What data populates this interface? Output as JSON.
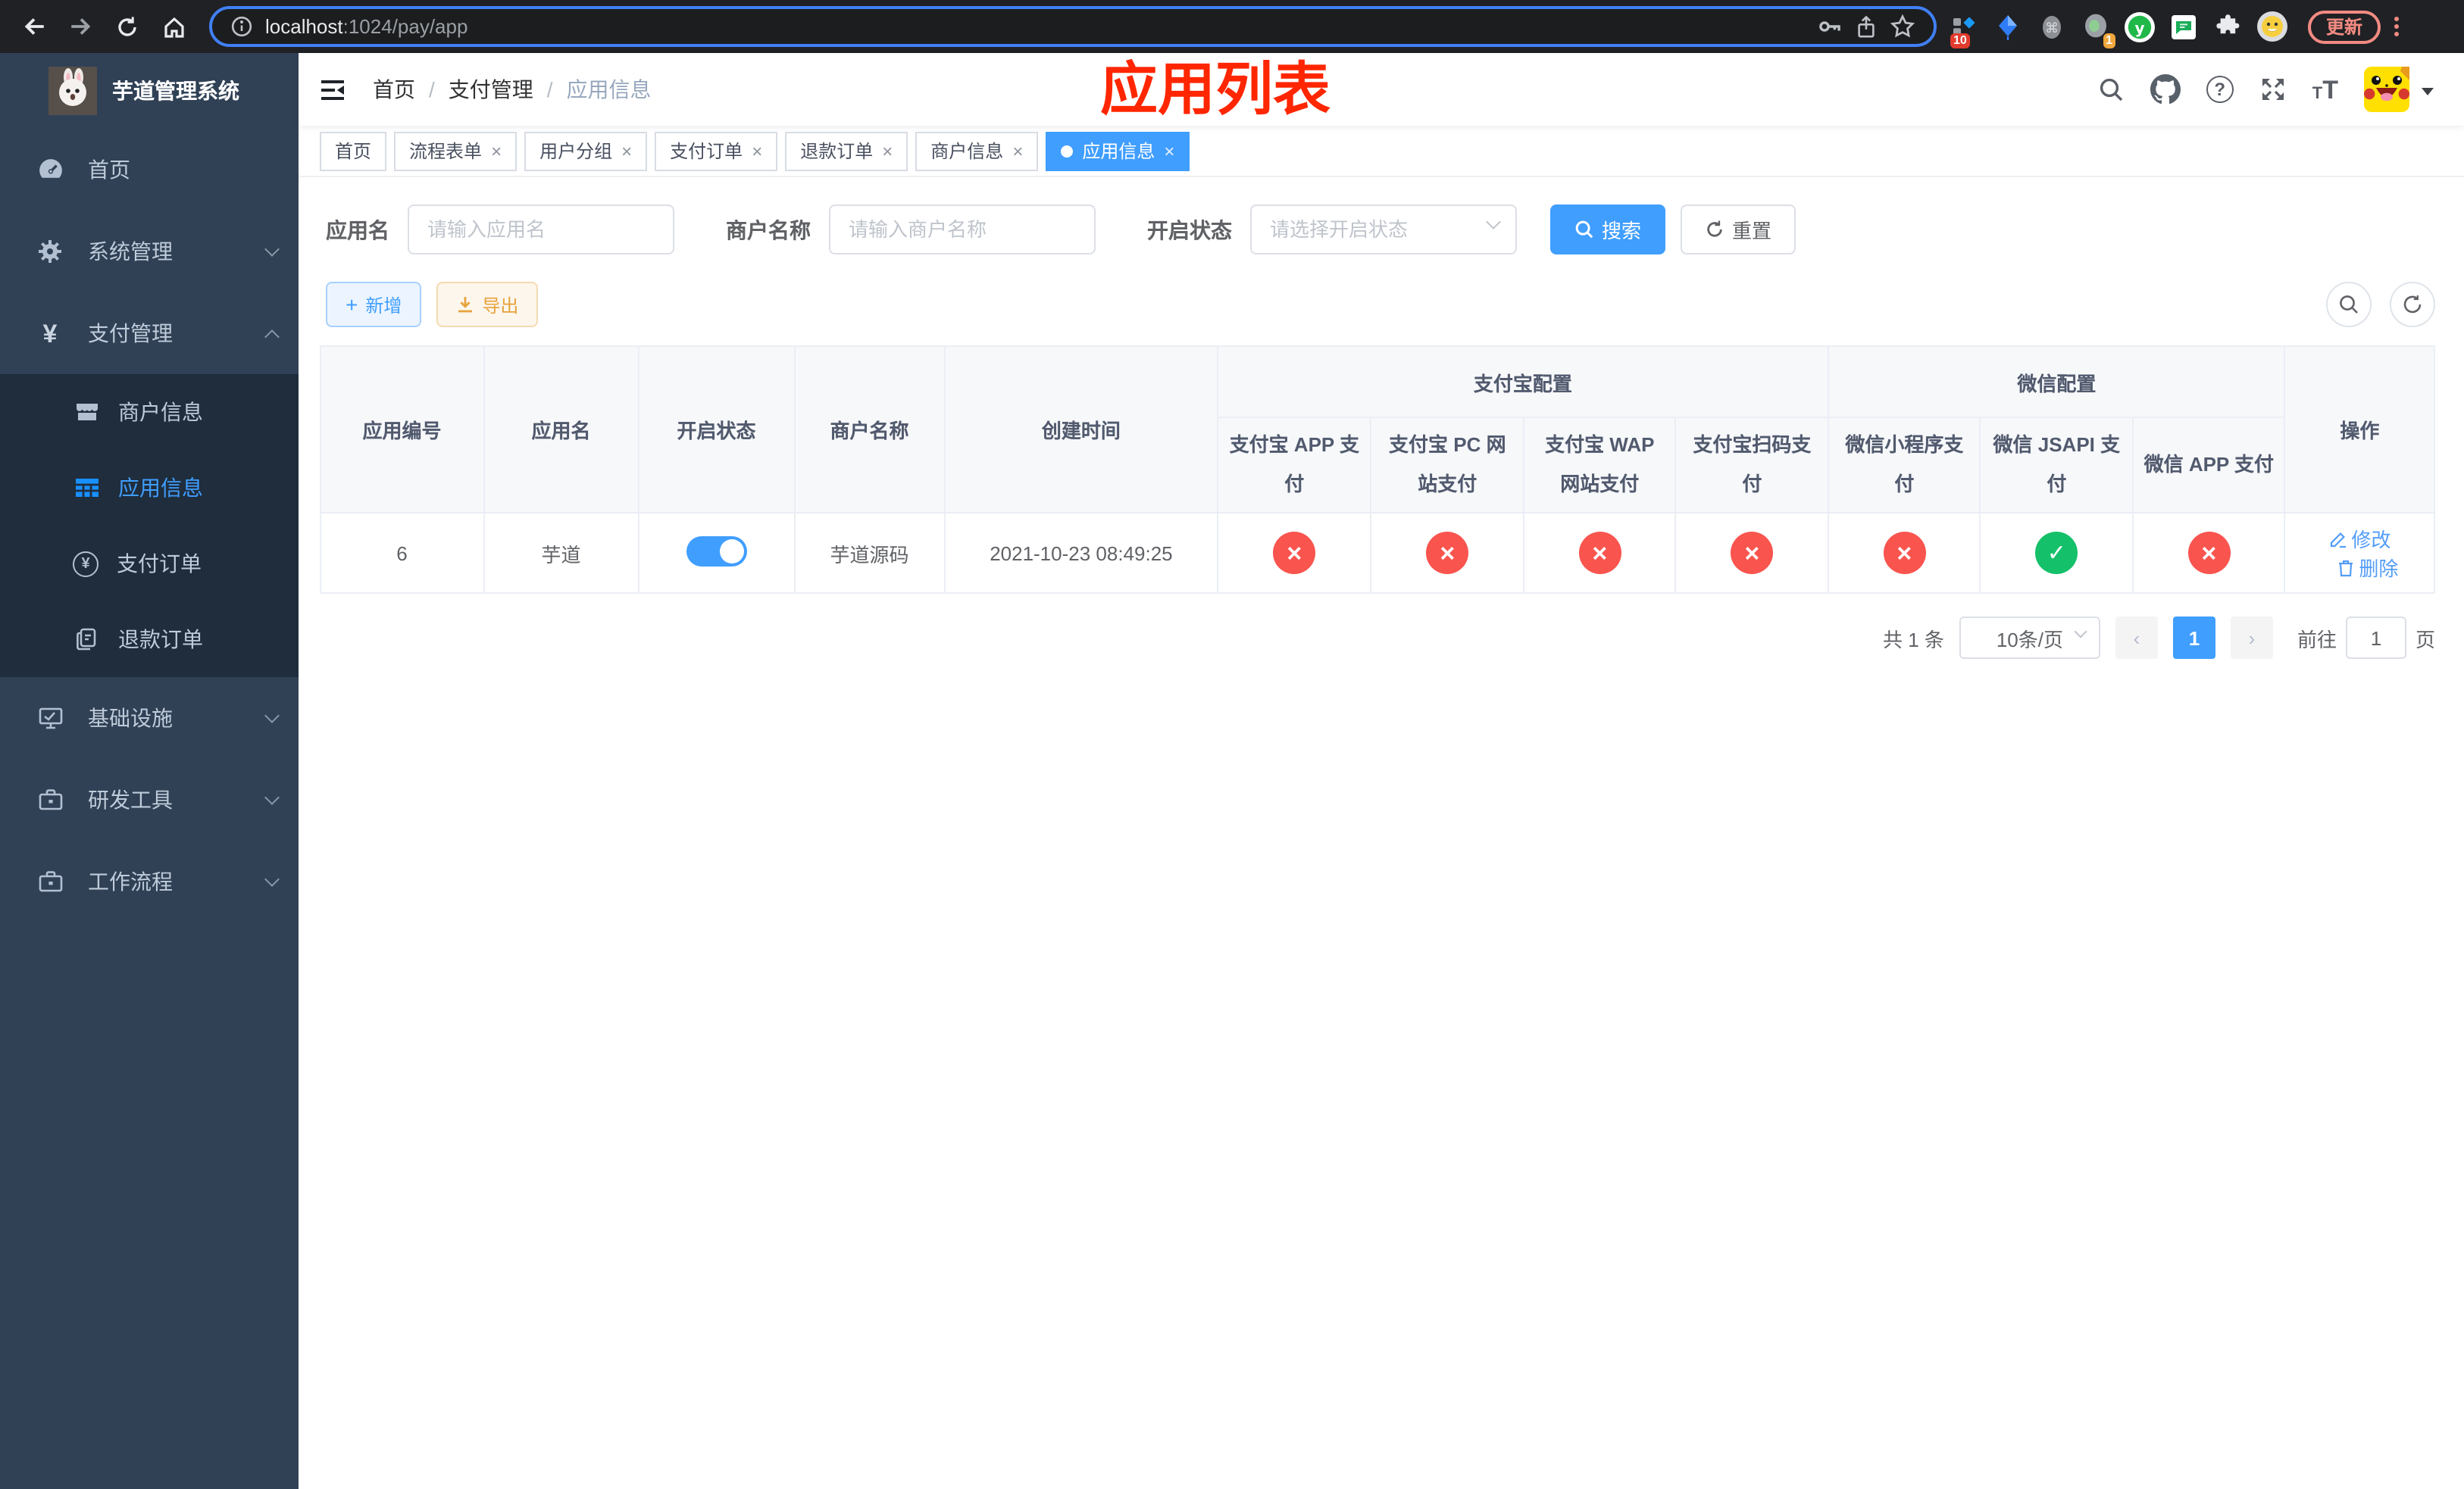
{
  "browser": {
    "url_host": "localhost",
    "url_path": ":1024/pay/app",
    "update_label": "更新",
    "ext_badges": {
      "blocker": "10",
      "recorder": "1"
    }
  },
  "sidebar": {
    "title": "芋道管理系统",
    "items": [
      {
        "label": "首页"
      },
      {
        "label": "系统管理"
      },
      {
        "label": "支付管理"
      },
      {
        "label": "商户信息"
      },
      {
        "label": "应用信息"
      },
      {
        "label": "支付订单"
      },
      {
        "label": "退款订单"
      },
      {
        "label": "基础设施"
      },
      {
        "label": "研发工具"
      },
      {
        "label": "工作流程"
      }
    ]
  },
  "header": {
    "breadcrumb": [
      "首页",
      "支付管理",
      "应用信息"
    ],
    "separator": "/",
    "annotation": "应用列表"
  },
  "tabs": [
    {
      "label": "首页"
    },
    {
      "label": "流程表单"
    },
    {
      "label": "用户分组"
    },
    {
      "label": "支付订单"
    },
    {
      "label": "退款订单"
    },
    {
      "label": "商户信息"
    },
    {
      "label": "应用信息"
    }
  ],
  "filters": {
    "name_label": "应用名",
    "name_placeholder": "请输入应用名",
    "merchant_label": "商户名称",
    "merchant_placeholder": "请输入商户名称",
    "status_label": "开启状态",
    "status_placeholder": "请选择开启状态",
    "search_label": "搜索",
    "reset_label": "重置"
  },
  "actions": {
    "add_label": "新增",
    "export_label": "导出"
  },
  "table": {
    "groups": {
      "alipay": "支付宝配置",
      "wechat": "微信配置"
    },
    "columns": [
      "应用编号",
      "应用名",
      "开启状态",
      "商户名称",
      "创建时间",
      "支付宝 APP 支付",
      "支付宝 PC 网站支付",
      "支付宝 WAP 网站支付",
      "支付宝扫码支付",
      "微信小程序支付",
      "微信 JSAPI 支付",
      "微信 APP 支付",
      "操作"
    ],
    "row": {
      "id": "6",
      "name": "芋道",
      "status": "on",
      "merchant": "芋道源码",
      "create_time": "2021-10-23 08:49:25",
      "channels": [
        {
          "label": "支付宝 APP 支付",
          "state": "off"
        },
        {
          "label": "支付宝 PC 网站支付",
          "state": "off"
        },
        {
          "label": "支付宝 WAP 网站支付",
          "state": "off"
        },
        {
          "label": "支付宝扫码支付",
          "state": "off"
        },
        {
          "label": "微信小程序支付",
          "state": "off"
        },
        {
          "label": "微信 JSAPI 支付",
          "state": "on"
        },
        {
          "label": "微信 APP 支付",
          "state": "off"
        }
      ],
      "edit_label": "修改",
      "delete_label": "删除"
    }
  },
  "pagination": {
    "total": "共 1 条",
    "page_size": "10条/页",
    "page": "1",
    "goto_prefix": "前往",
    "goto_value": "1",
    "goto_suffix": "页"
  },
  "colors": {
    "primary": "#409eff",
    "success": "#15c06a",
    "danger": "#f9544e",
    "warning": "#e6a23c",
    "annotation": "#ff2600",
    "sidebar_bg": "#304156",
    "submenu_bg": "#1f2d3d"
  }
}
